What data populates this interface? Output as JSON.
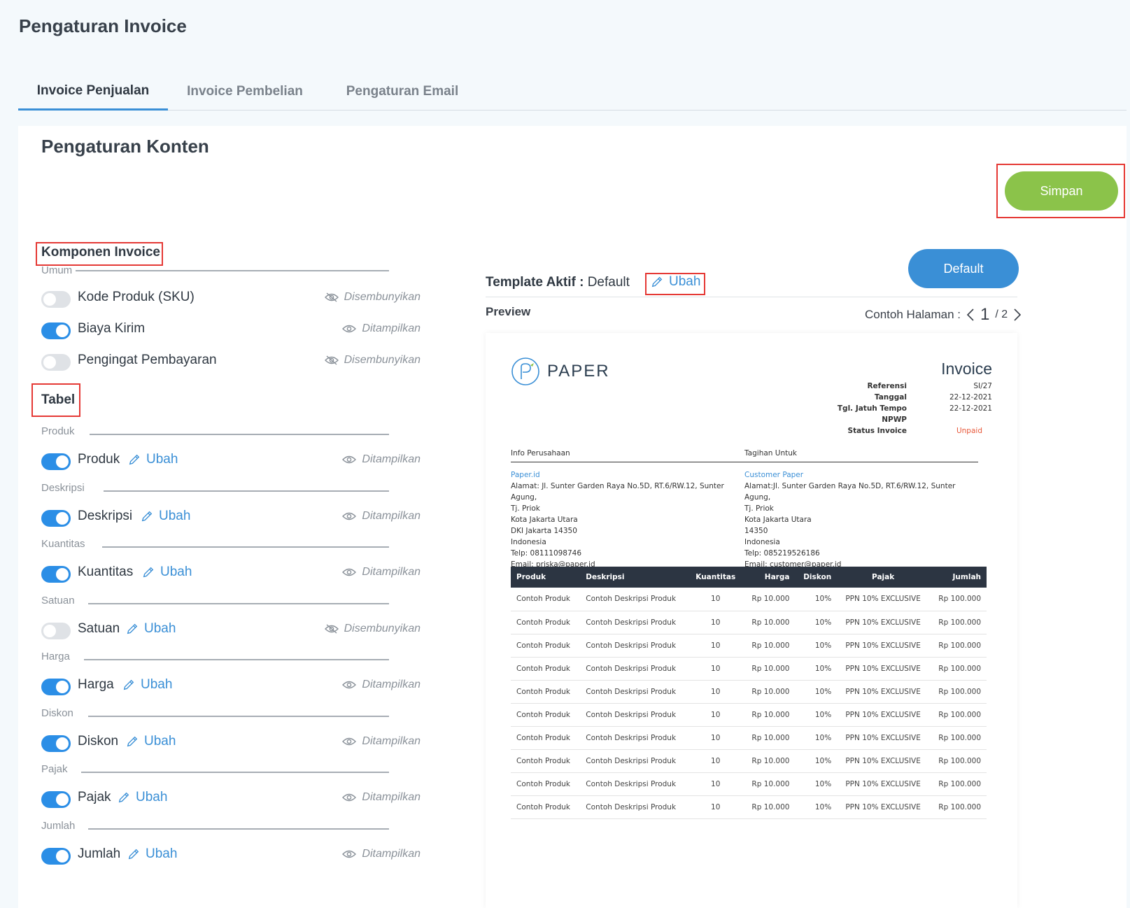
{
  "page_title": "Pengaturan Invoice",
  "tabs": [
    {
      "label": "Invoice Penjualan",
      "active": true
    },
    {
      "label": "Invoice Pembelian",
      "active": false
    },
    {
      "label": "Pengaturan Email",
      "active": false
    }
  ],
  "section_title": "Pengaturan Konten",
  "save_label": "Simpan",
  "komponen": {
    "title": "Komponen Invoice",
    "umum_label": "Umum",
    "items": [
      {
        "label": "Kode Produk (SKU)",
        "on": false,
        "status": "Disembunyikan"
      },
      {
        "label": "Biaya Kirim",
        "on": true,
        "status": "Ditampilkan"
      },
      {
        "label": "Pengingat Pembayaran",
        "on": false,
        "status": "Disembunyikan"
      }
    ]
  },
  "tabel": {
    "title": "Tabel",
    "edit_label": "Ubah",
    "groups": [
      {
        "section": "Produk",
        "label": "Produk",
        "on": true,
        "status": "Ditampilkan"
      },
      {
        "section": "Deskripsi",
        "label": "Deskripsi",
        "on": true,
        "status": "Ditampilkan"
      },
      {
        "section": "Kuantitas",
        "label": "Kuantitas",
        "on": true,
        "status": "Ditampilkan"
      },
      {
        "section": "Satuan",
        "label": "Satuan",
        "on": false,
        "status": "Disembunyikan"
      },
      {
        "section": "Harga",
        "label": "Harga",
        "on": true,
        "status": "Ditampilkan"
      },
      {
        "section": "Diskon",
        "label": "Diskon",
        "on": true,
        "status": "Ditampilkan"
      },
      {
        "section": "Pajak",
        "label": "Pajak",
        "on": true,
        "status": "Ditampilkan"
      },
      {
        "section": "Jumlah",
        "label": "Jumlah",
        "on": true,
        "status": "Ditampilkan"
      }
    ]
  },
  "template": {
    "label": "Template Aktif :",
    "value": "Default",
    "edit_label": "Ubah",
    "default_button": "Default"
  },
  "preview": {
    "label": "Preview",
    "pager_label": "Contoh Halaman :",
    "current_page": "1",
    "total_pages": "/ 2"
  },
  "invoice": {
    "logo_text": "PAPER",
    "title": "Invoice",
    "meta": [
      {
        "k": "Referensi",
        "v": "SI/27"
      },
      {
        "k": "Tanggal",
        "v": "22-12-2021"
      },
      {
        "k": "Tgl. Jatuh Tempo",
        "v": "22-12-2021"
      },
      {
        "k": "NPWP",
        "v": ""
      },
      {
        "k": "Status Invoice",
        "v": "Unpaid"
      }
    ],
    "company": {
      "head": "Info Perusahaan",
      "name": "Paper.id",
      "lines": [
        "Alamat: Jl. Sunter Garden Raya No.5D, RT.6/RW.12, Sunter Agung,",
        "Tj. Priok",
        "Kota Jakarta Utara",
        "DKI Jakarta 14350",
        "Indonesia",
        "Telp: 08111098746",
        "Email: priska@paper.id"
      ]
    },
    "billing": {
      "head": "Tagihan Untuk",
      "name": "Customer Paper",
      "lines": [
        "Alamat:Jl. Sunter Garden Raya No.5D, RT.6/RW.12, Sunter Agung,",
        "Tj. Priok",
        "Kota Jakarta Utara",
        "14350",
        "Indonesia",
        "Telp: 085219526186",
        "Email: customer@paper.id"
      ]
    },
    "table_headers": [
      "Produk",
      "Deskripsi",
      "Kuantitas",
      "Harga",
      "Diskon",
      "Pajak",
      "Jumlah"
    ],
    "table_rows": [
      [
        "Contoh Produk",
        "Contoh Deskripsi Produk",
        "10",
        "Rp 10.000",
        "10%",
        "PPN 10% EXCLUSIVE",
        "Rp 100.000"
      ],
      [
        "Contoh Produk",
        "Contoh Deskripsi Produk",
        "10",
        "Rp 10.000",
        "10%",
        "PPN 10% EXCLUSIVE",
        "Rp 100.000"
      ],
      [
        "Contoh Produk",
        "Contoh Deskripsi Produk",
        "10",
        "Rp 10.000",
        "10%",
        "PPN 10% EXCLUSIVE",
        "Rp 100.000"
      ],
      [
        "Contoh Produk",
        "Contoh Deskripsi Produk",
        "10",
        "Rp 10.000",
        "10%",
        "PPN 10% EXCLUSIVE",
        "Rp 100.000"
      ],
      [
        "Contoh Produk",
        "Contoh Deskripsi Produk",
        "10",
        "Rp 10.000",
        "10%",
        "PPN 10% EXCLUSIVE",
        "Rp 100.000"
      ],
      [
        "Contoh Produk",
        "Contoh Deskripsi Produk",
        "10",
        "Rp 10.000",
        "10%",
        "PPN 10% EXCLUSIVE",
        "Rp 100.000"
      ],
      [
        "Contoh Produk",
        "Contoh Deskripsi Produk",
        "10",
        "Rp 10.000",
        "10%",
        "PPN 10% EXCLUSIVE",
        "Rp 100.000"
      ],
      [
        "Contoh Produk",
        "Contoh Deskripsi Produk",
        "10",
        "Rp 10.000",
        "10%",
        "PPN 10% EXCLUSIVE",
        "Rp 100.000"
      ],
      [
        "Contoh Produk",
        "Contoh Deskripsi Produk",
        "10",
        "Rp 10.000",
        "10%",
        "PPN 10% EXCLUSIVE",
        "Rp 100.000"
      ],
      [
        "Contoh Produk",
        "Contoh Deskripsi Produk",
        "10",
        "Rp 10.000",
        "10%",
        "PPN 10% EXCLUSIVE",
        "Rp 100.000"
      ]
    ]
  },
  "colors": {
    "accent": "#3a8fd6",
    "save": "#8bc34a",
    "toggle_on": "#2b8ee6",
    "toggle_off": "#dfe2e6",
    "highlight_box": "#e53935",
    "unpaid": "#e8583a"
  }
}
